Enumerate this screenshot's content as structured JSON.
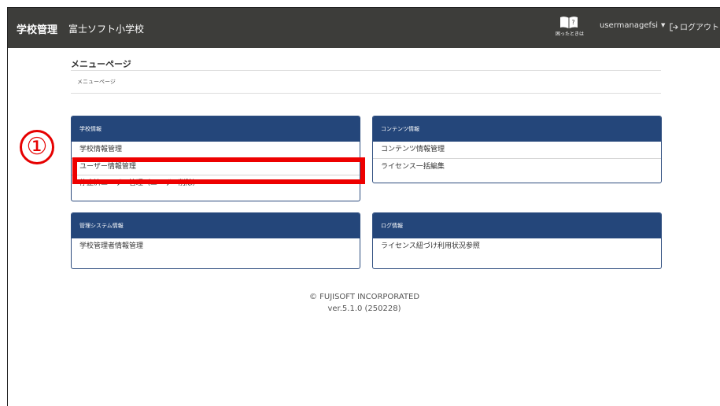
{
  "header": {
    "brand": "学校管理",
    "school_name": "富士ソフト小学校",
    "help_label": "困ったときは",
    "user": "usermanagefsi",
    "logout": "ログアウト"
  },
  "page": {
    "title": "メニューページ",
    "breadcrumb": "メニューページ"
  },
  "panels": [
    {
      "title": "学校情報",
      "items": [
        "学校情報管理",
        "ユーザー情報管理",
        "停止済ユーザー管理（ユーザー削除）"
      ]
    },
    {
      "title": "コンテンツ情報",
      "items": [
        "コンテンツ情報管理",
        "ライセンス一括編集"
      ]
    },
    {
      "title": "管理システム情報",
      "items": [
        "学校管理者情報管理"
      ]
    },
    {
      "title": "ログ情報",
      "items": [
        "ライセンス紐づけ利用状況参照"
      ]
    }
  ],
  "annotation": {
    "number": "①",
    "color": "#e60000"
  },
  "footer": {
    "copyright": "© FUJISOFT INCORPORATED",
    "version": "ver.5.1.0 (250228)"
  },
  "colors": {
    "topbar": "#3d3d3a",
    "panel_header": "#24467a",
    "highlight": "#ee0000"
  }
}
